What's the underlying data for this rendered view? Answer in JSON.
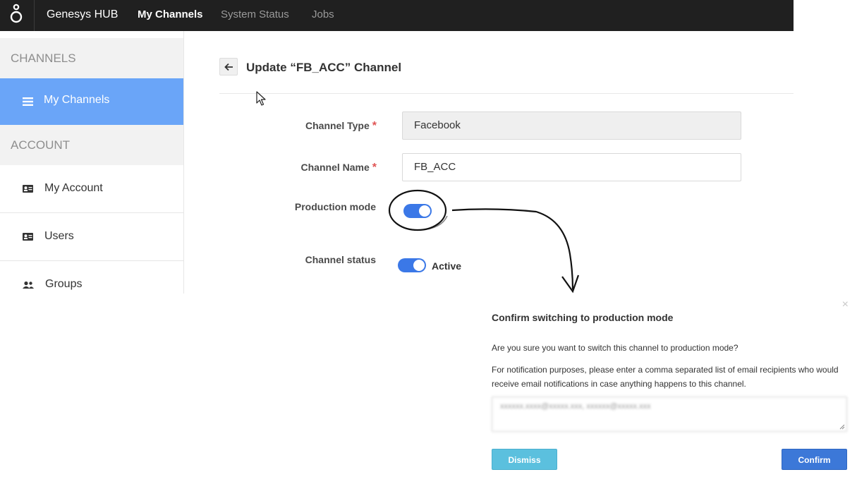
{
  "topbar": {
    "brand": "Genesys HUB",
    "nav": [
      {
        "label": "My Channels",
        "active": true
      },
      {
        "label": "System Status",
        "active": false
      },
      {
        "label": "Jobs",
        "active": false
      }
    ],
    "logo_icon": "genesys-logo-icon"
  },
  "sidebar": {
    "sections": [
      {
        "heading": "CHANNELS"
      },
      {
        "heading": "ACCOUNT"
      }
    ],
    "active_item": {
      "label": "My Channels",
      "icon": "list-icon"
    },
    "items": [
      {
        "label": "My Account",
        "icon": "id-card-icon"
      },
      {
        "label": "Users",
        "icon": "id-card-icon"
      },
      {
        "label": "Groups",
        "icon": "users-icon"
      }
    ]
  },
  "main": {
    "title": "Update “FB_ACC” Channel",
    "back_icon": "arrow-left-icon",
    "form": {
      "channel_type_label": "Channel Type",
      "channel_type_value": "Facebook",
      "channel_name_label": "Channel Name",
      "channel_name_value": "FB_ACC",
      "required_mark": "*",
      "production_mode_label": "Production mode",
      "production_mode_on": true,
      "channel_status_label": "Channel status",
      "channel_status_on": true,
      "channel_status_text": "Active"
    }
  },
  "modal": {
    "close_symbol": "×",
    "title": "Confirm switching to production mode",
    "question": "Are you sure you want to switch this channel to production mode?",
    "description": "For notification purposes, please enter a comma separated list of email recipients who would receive email notifications in case anything happens to this channel.",
    "recipients_value": "xxxxxx.xxxx@xxxxx.xxx, xxxxxx@xxxxx.xxx",
    "dismiss_label": "Dismiss",
    "confirm_label": "Confirm"
  },
  "colors": {
    "topbar": "#202020",
    "sidebar_active": "#6aa5f8",
    "toggle_on": "#3b78e7",
    "dismiss": "#5bc0de",
    "confirm": "#3c78d8",
    "required": "#e05454"
  }
}
